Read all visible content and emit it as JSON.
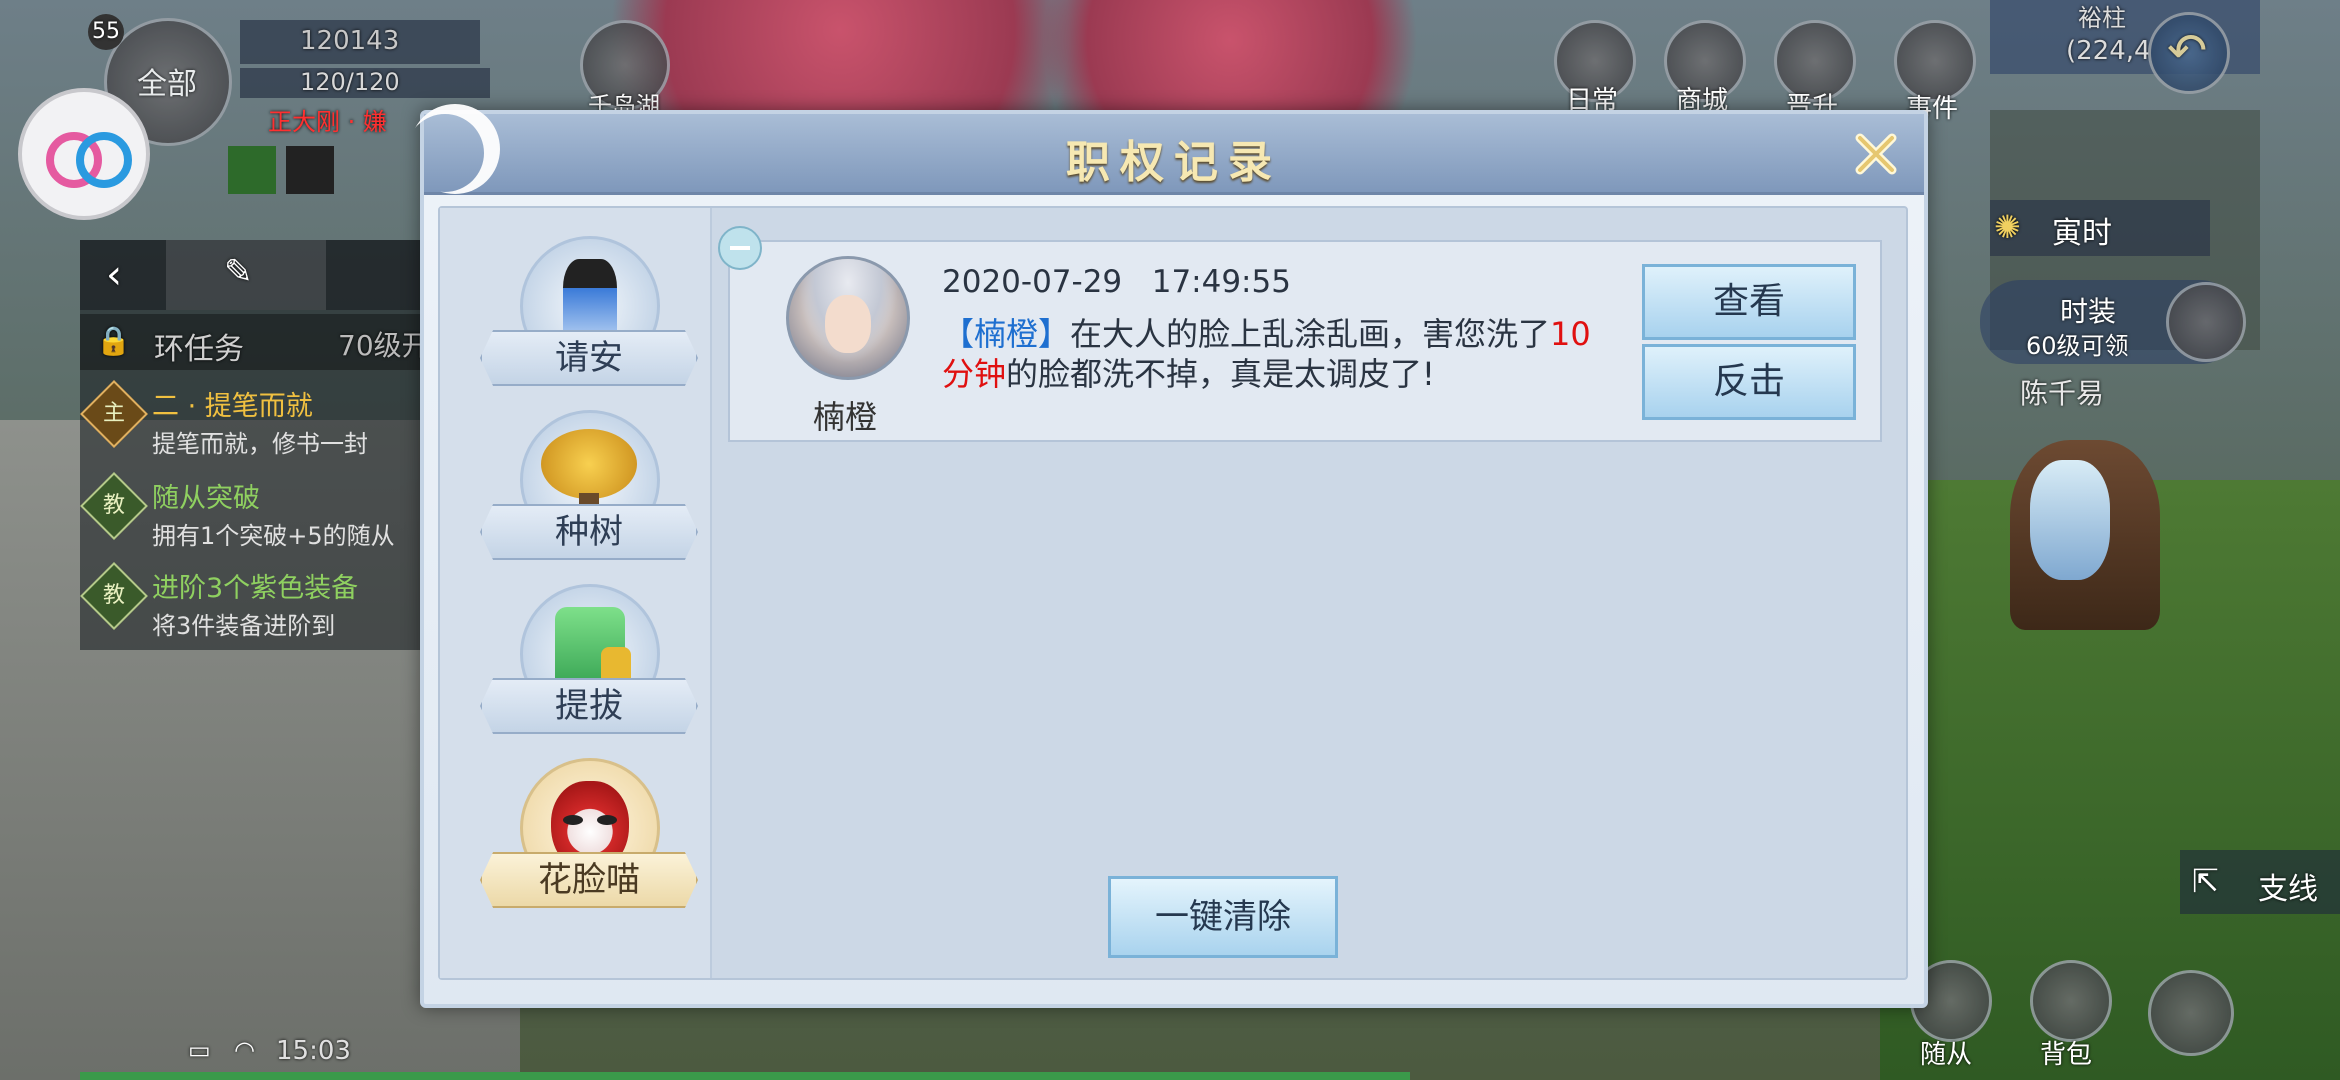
{
  "hud": {
    "level": "55",
    "all_label": "全部",
    "power": "120143",
    "stamina": "120/120",
    "faction": "正大刚 · 嫌",
    "top_icons": [
      {
        "label": "千岛湖",
        "icon": "island-icon"
      },
      {
        "label": "日常",
        "icon": "daily-icon"
      },
      {
        "label": "商城",
        "icon": "shop-icon"
      },
      {
        "label": "晋升",
        "icon": "promote-icon"
      },
      {
        "label": "事件",
        "icon": "event-icon"
      }
    ],
    "map_name": "裕柱",
    "coords": "(224,4",
    "time_label": "寅时",
    "fashion_label": "时装",
    "fashion_sub": "60级可领",
    "npc_name": "陈千易",
    "branch_label": "支线",
    "bottom_icons": [
      {
        "label": "随从",
        "icon": "follower-icon"
      },
      {
        "label": "背包",
        "icon": "bag-icon"
      }
    ],
    "status_time": "15:03"
  },
  "tasks": {
    "header": "环任务",
    "header_level": "70级开",
    "items": [
      {
        "badge": "主",
        "title": "二 · 提笔而就",
        "sub": "提笔而就，修书一封"
      },
      {
        "badge": "教",
        "title": "随从突破",
        "sub": "拥有1个突破+5的随从"
      },
      {
        "badge": "教",
        "title": "进阶3个紫色装备",
        "sub": "将3件装备进阶到"
      }
    ]
  },
  "dialog": {
    "title": "职权记录",
    "sidebar": [
      {
        "label": "请安",
        "icon": "greeting-icon",
        "active": false
      },
      {
        "label": "种树",
        "icon": "money-tree-icon",
        "active": false
      },
      {
        "label": "提拔",
        "icon": "jade-seal-icon",
        "active": false
      },
      {
        "label": "花脸喵",
        "icon": "opera-mask-icon",
        "active": true
      }
    ],
    "record": {
      "avatar_name": "楠橙",
      "time": "2020-07-29   17:49:55",
      "msg_name": "【楠橙】",
      "msg_part1": "在大人的脸上乱涂乱画，害您洗了",
      "msg_highlight": "10分钟",
      "msg_part2": "的脸都洗不掉，真是太调皮了!",
      "view_label": "查看",
      "counter_label": "反击"
    },
    "clear_label": "一键清除"
  },
  "colors": {
    "title_gold": "#f6e8b2",
    "highlight_blue": "#1e6fd0",
    "highlight_red": "#e01010",
    "button_blue": "#a8d2ee"
  }
}
